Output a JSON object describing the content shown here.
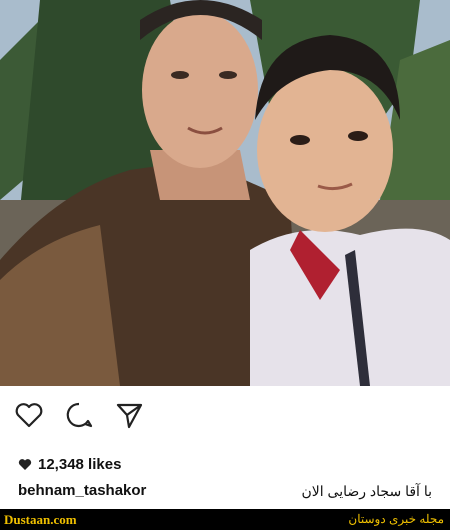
{
  "post": {
    "likes": "12,348 likes",
    "username": "behnam_tashakor",
    "caption": "با آقا سجاد رضایی الان"
  },
  "actions": [
    {
      "icon": "heart-outline-icon"
    },
    {
      "icon": "comment-icon"
    },
    {
      "icon": "share-icon"
    }
  ],
  "footer": {
    "site": "Dustaan.com",
    "tagline": "مجله خبری دوستان"
  },
  "colors": {
    "footer_bg": "#000000",
    "footer_text": "#f0c000",
    "text": "#111111"
  }
}
